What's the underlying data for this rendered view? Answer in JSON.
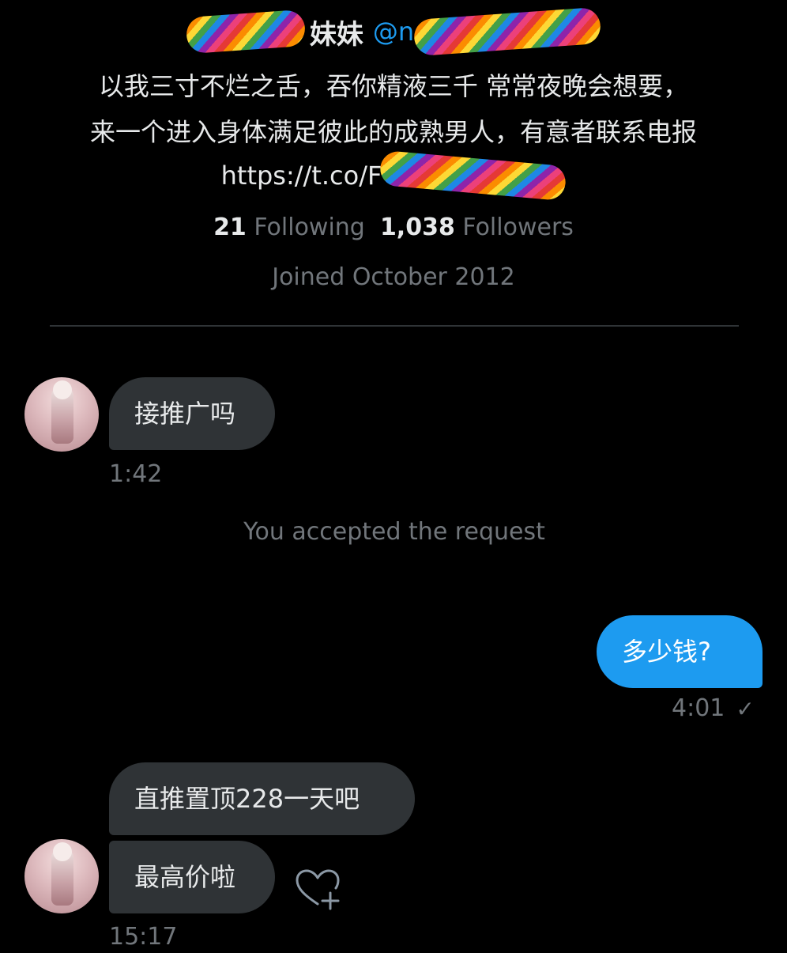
{
  "profile": {
    "display_name": "妹妹",
    "handle_prefix": "@n",
    "bio_line1": "以我三寸不烂之舌，吞你精液三千 常常夜晚会想要，",
    "bio_line2": "来一个进入身体满足彼此的成熟男人，有意者联系电报",
    "bio_link": "https://t.co/F",
    "following_count": "21",
    "following_label": "Following",
    "followers_count": "1,038",
    "followers_label": "Followers",
    "joined": "Joined October 2012"
  },
  "conversation": {
    "messages": [
      {
        "direction": "incoming",
        "text": "接推广吗",
        "time": "1:42"
      },
      {
        "direction": "system",
        "text": "You accepted the request"
      },
      {
        "direction": "outgoing",
        "text": "多少钱?",
        "time": "4:01",
        "status": "✓"
      },
      {
        "direction": "incoming",
        "text": "直推置顶228一天吧"
      },
      {
        "direction": "incoming",
        "text": "最高价啦",
        "time": "15:17"
      }
    ]
  },
  "icons": {
    "redaction": "rainbow-scribble",
    "reaction": "heart-plus-icon"
  },
  "colors": {
    "background": "#000000",
    "incoming_bubble": "#2f3336",
    "outgoing_bubble": "#1d9bf0",
    "muted_text": "#71767b",
    "accent": "#1d9bf0"
  }
}
